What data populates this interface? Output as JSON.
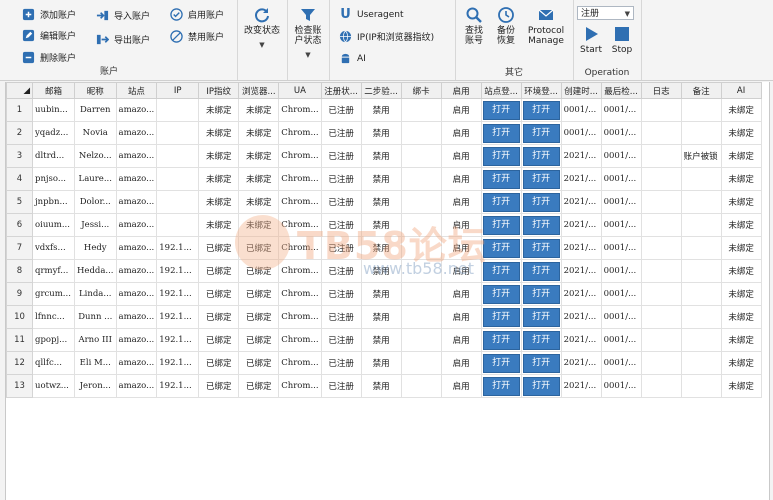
{
  "ribbon": {
    "account_group": {
      "title": "账户",
      "add": "添加账户",
      "edit": "编辑账户",
      "delete": "删除账户",
      "import": "导入账户",
      "export": "导出账户",
      "enable": "启用账户",
      "disable": "禁用账户"
    },
    "change_status": "改变状态",
    "check_status": "检查账户状态",
    "useragent": "Useragent",
    "ip_fingerprint": "IP(IP和浏览器指纹)",
    "ai": "AI",
    "tools_group": {
      "title": "其它",
      "check_account": "查找账号",
      "backup_restore": "备份恢复",
      "protocol_manage": "Protocol Manage"
    },
    "operation_group": {
      "title": "Operation",
      "select_value": "注册",
      "start": "Start",
      "stop": "Stop"
    }
  },
  "table": {
    "columns": [
      "邮箱",
      "昵称",
      "站点",
      "IP",
      "IP指纹",
      "浏览器...",
      "UA",
      "注册状...",
      "二步验...",
      "绑卡",
      "启用",
      "站点登...",
      "环境登...",
      "创建时...",
      "最后检...",
      "日志",
      "备注",
      "AI"
    ],
    "rows": [
      {
        "n": "1",
        "email": "uubin...",
        "nick": "Darren",
        "site": "amazo...",
        "ip": "",
        "ipfp": "未绑定",
        "browser": "未绑定",
        "ua": "Chrom...",
        "reg": "已注册",
        "twofa": "禁用",
        "card": "",
        "enabled": "启用",
        "site_login": "打开",
        "env_login": "打开",
        "created": "0001/...",
        "last_check": "0001/...",
        "log": "",
        "note": "",
        "ai": "未绑定"
      },
      {
        "n": "2",
        "email": "yqadz...",
        "nick": "Novia",
        "site": "amazo...",
        "ip": "",
        "ipfp": "未绑定",
        "browser": "未绑定",
        "ua": "Chrom...",
        "reg": "已注册",
        "twofa": "禁用",
        "card": "",
        "enabled": "启用",
        "site_login": "打开",
        "env_login": "打开",
        "created": "0001/...",
        "last_check": "0001/...",
        "log": "",
        "note": "",
        "ai": "未绑定"
      },
      {
        "n": "3",
        "email": "dltrd...",
        "nick": "Nelzo...",
        "site": "amazo...",
        "ip": "",
        "ipfp": "未绑定",
        "browser": "未绑定",
        "ua": "Chrom...",
        "reg": "已注册",
        "twofa": "禁用",
        "card": "",
        "enabled": "启用",
        "site_login": "打开",
        "env_login": "打开",
        "created": "2021/...",
        "last_check": "0001/...",
        "log": "",
        "note": "账户被锁",
        "ai": "未绑定"
      },
      {
        "n": "4",
        "email": "pnjso...",
        "nick": "Laure...",
        "site": "amazo...",
        "ip": "",
        "ipfp": "未绑定",
        "browser": "未绑定",
        "ua": "Chrom...",
        "reg": "已注册",
        "twofa": "禁用",
        "card": "",
        "enabled": "启用",
        "site_login": "打开",
        "env_login": "打开",
        "created": "2021/...",
        "last_check": "0001/...",
        "log": "",
        "note": "",
        "ai": "未绑定"
      },
      {
        "n": "5",
        "email": "jnpbn...",
        "nick": "Dolor...",
        "site": "amazo...",
        "ip": "",
        "ipfp": "未绑定",
        "browser": "未绑定",
        "ua": "Chrom...",
        "reg": "已注册",
        "twofa": "禁用",
        "card": "",
        "enabled": "启用",
        "site_login": "打开",
        "env_login": "打开",
        "created": "2021/...",
        "last_check": "0001/...",
        "log": "",
        "note": "",
        "ai": "未绑定"
      },
      {
        "n": "6",
        "email": "oiuum...",
        "nick": "Jessi...",
        "site": "amazo...",
        "ip": "",
        "ipfp": "未绑定",
        "browser": "未绑定",
        "ua": "Chrom...",
        "reg": "已注册",
        "twofa": "禁用",
        "card": "",
        "enabled": "启用",
        "site_login": "打开",
        "env_login": "打开",
        "created": "2021/...",
        "last_check": "0001/...",
        "log": "",
        "note": "",
        "ai": "未绑定"
      },
      {
        "n": "7",
        "email": "vdxfs...",
        "nick": "Hedy",
        "site": "amazo...",
        "ip": "192.1...",
        "ipfp": "已绑定",
        "browser": "已绑定",
        "ua": "Chrom...",
        "reg": "已注册",
        "twofa": "禁用",
        "card": "",
        "enabled": "启用",
        "site_login": "打开",
        "env_login": "打开",
        "created": "2021/...",
        "last_check": "0001/...",
        "log": "",
        "note": "",
        "ai": "未绑定"
      },
      {
        "n": "8",
        "email": "qrmyf...",
        "nick": "Hedda...",
        "site": "amazo...",
        "ip": "192.1...",
        "ipfp": "已绑定",
        "browser": "已绑定",
        "ua": "Chrom...",
        "reg": "已注册",
        "twofa": "禁用",
        "card": "",
        "enabled": "启用",
        "site_login": "打开",
        "env_login": "打开",
        "created": "2021/...",
        "last_check": "0001/...",
        "log": "",
        "note": "",
        "ai": "未绑定"
      },
      {
        "n": "9",
        "email": "grcum...",
        "nick": "Linda...",
        "site": "amazo...",
        "ip": "192.1...",
        "ipfp": "已绑定",
        "browser": "已绑定",
        "ua": "Chrom...",
        "reg": "已注册",
        "twofa": "禁用",
        "card": "",
        "enabled": "启用",
        "site_login": "打开",
        "env_login": "打开",
        "created": "2021/...",
        "last_check": "0001/...",
        "log": "",
        "note": "",
        "ai": "未绑定"
      },
      {
        "n": "10",
        "email": "lfnnc...",
        "nick": "Dunn ...",
        "site": "amazo...",
        "ip": "192.1...",
        "ipfp": "已绑定",
        "browser": "已绑定",
        "ua": "Chrom...",
        "reg": "已注册",
        "twofa": "禁用",
        "card": "",
        "enabled": "启用",
        "site_login": "打开",
        "env_login": "打开",
        "created": "2021/...",
        "last_check": "0001/...",
        "log": "",
        "note": "",
        "ai": "未绑定"
      },
      {
        "n": "11",
        "email": "gpopj...",
        "nick": "Arno III",
        "site": "amazo...",
        "ip": "192.1...",
        "ipfp": "已绑定",
        "browser": "已绑定",
        "ua": "Chrom...",
        "reg": "已注册",
        "twofa": "禁用",
        "card": "",
        "enabled": "启用",
        "site_login": "打开",
        "env_login": "打开",
        "created": "2021/...",
        "last_check": "0001/...",
        "log": "",
        "note": "",
        "ai": "未绑定"
      },
      {
        "n": "12",
        "email": "qllfc...",
        "nick": "Eli M...",
        "site": "amazo...",
        "ip": "192.1...",
        "ipfp": "已绑定",
        "browser": "已绑定",
        "ua": "Chrom...",
        "reg": "已注册",
        "twofa": "禁用",
        "card": "",
        "enabled": "启用",
        "site_login": "打开",
        "env_login": "打开",
        "created": "2021/...",
        "last_check": "0001/...",
        "log": "",
        "note": "",
        "ai": "未绑定"
      },
      {
        "n": "13",
        "email": "uotwz...",
        "nick": "Jeron...",
        "site": "amazo...",
        "ip": "192.1...",
        "ipfp": "已绑定",
        "browser": "已绑定",
        "ua": "Chrom...",
        "reg": "已注册",
        "twofa": "禁用",
        "card": "",
        "enabled": "启用",
        "site_login": "打开",
        "env_login": "打开",
        "created": "2021/...",
        "last_check": "0001/...",
        "log": "",
        "note": "",
        "ai": "未绑定"
      }
    ]
  },
  "watermark": {
    "title": "TB58论坛",
    "url": "www.tb58.net"
  }
}
